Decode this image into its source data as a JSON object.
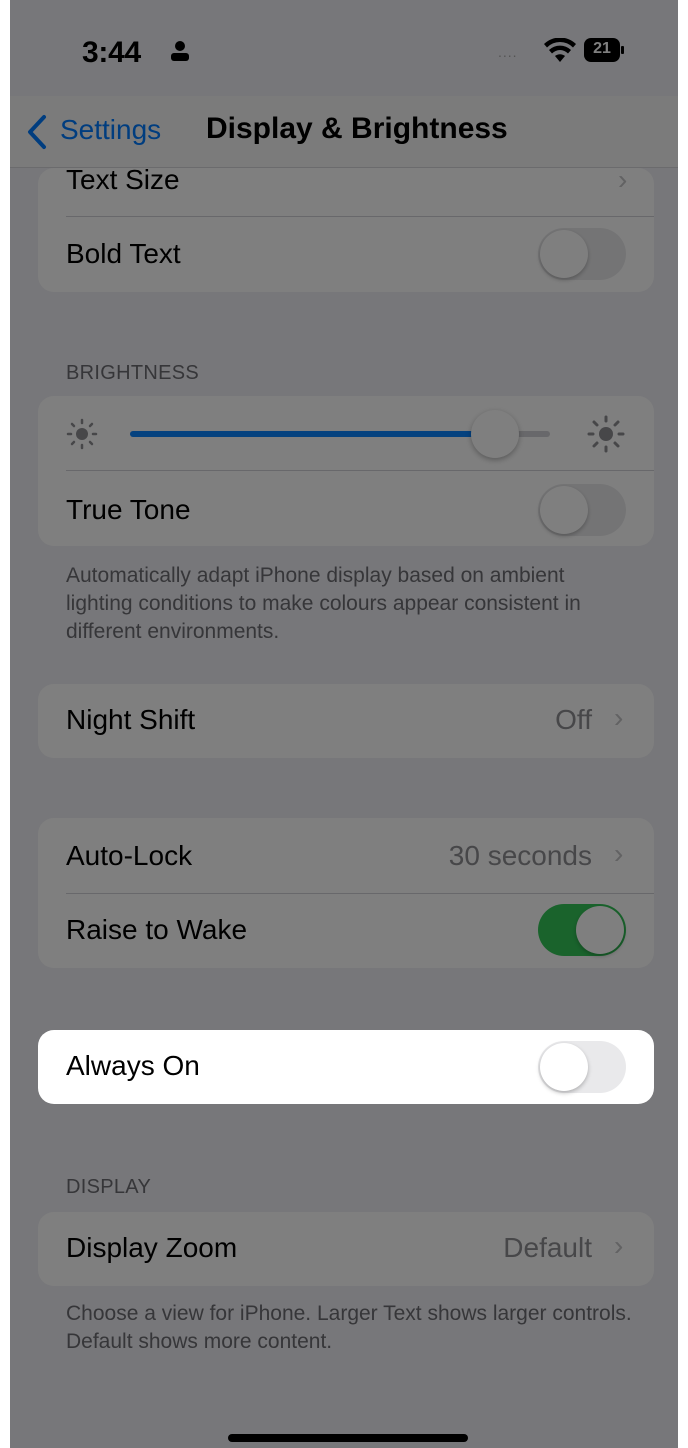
{
  "status_bar": {
    "time": "3:44",
    "battery_level": "21",
    "signal_dots": "....",
    "icons": [
      "person-icon",
      "wifi-icon",
      "battery-icon"
    ]
  },
  "nav": {
    "back_label": "Settings",
    "title": "Display & Brightness"
  },
  "text_group": {
    "text_size_label": "Text Size",
    "bold_text_label": "Bold Text",
    "bold_text_on": false
  },
  "brightness": {
    "header": "BRIGHTNESS",
    "level": 0.87,
    "true_tone_label": "True Tone",
    "true_tone_on": false,
    "footer": "Automatically adapt iPhone display based on ambient lighting conditions to make colours appear consistent in different environments."
  },
  "night_shift": {
    "label": "Night Shift",
    "value": "Off"
  },
  "lock_group": {
    "auto_lock_label": "Auto-Lock",
    "auto_lock_value": "30 seconds",
    "raise_to_wake_label": "Raise to Wake",
    "raise_to_wake_on": true
  },
  "always_on": {
    "label": "Always On",
    "on": false
  },
  "display": {
    "header": "DISPLAY",
    "zoom_label": "Display Zoom",
    "zoom_value": "Default",
    "footer": "Choose a view for iPhone. Larger Text shows larger controls. Default shows more content."
  },
  "colors": {
    "accent": "#007aff",
    "toggle_on": "#34c759",
    "slider_fill": "#0a84ff"
  }
}
